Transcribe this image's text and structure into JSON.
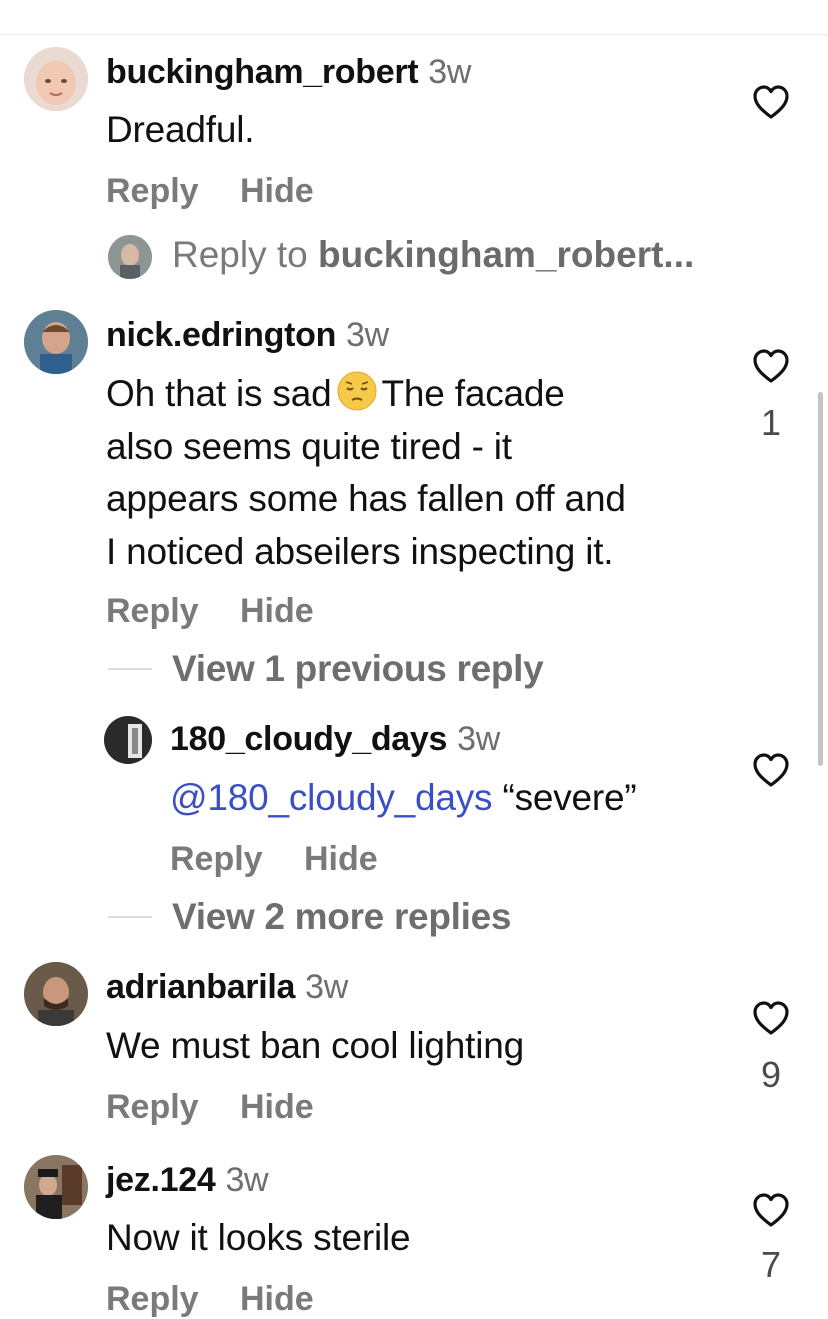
{
  "comments": [
    {
      "username": "buckingham_robert",
      "time": "3w",
      "text": "Dreadful.",
      "reply": "Reply",
      "hide": "Hide"
    },
    {
      "username": "nick.edrington",
      "time": "3w",
      "text_before_emoji": "Oh that is sad",
      "text_first_line_end": "The facade",
      "text_line2": "also seems quite tired - it",
      "text_line3": "appears some has fallen off and",
      "text_line4": "I noticed abseilers inspecting it.",
      "emoji": "pensive-face",
      "likes": "1",
      "reply": "Reply",
      "hide": "Hide",
      "view_previous": "View 1 previous reply",
      "view_more": "View 2 more replies"
    },
    {
      "username": "180_cloudy_days",
      "time": "3w",
      "mention": "@180_cloudy_days",
      "text": "“severe”",
      "reply": "Reply",
      "hide": "Hide"
    },
    {
      "username": "adrianbarila",
      "time": "3w",
      "text": "We must ban cool lighting",
      "likes": "9",
      "reply": "Reply",
      "hide": "Hide"
    },
    {
      "username": "jez.124",
      "time": "3w",
      "text": "Now it looks sterile",
      "likes": "7",
      "reply": "Reply",
      "hide": "Hide"
    }
  ],
  "reply_to": {
    "prefix": "Reply to",
    "target": "buckingham_robert..."
  },
  "colors": {
    "text": "#111111",
    "secondary": "#7a7a7a",
    "mention": "#3b4fc4"
  }
}
